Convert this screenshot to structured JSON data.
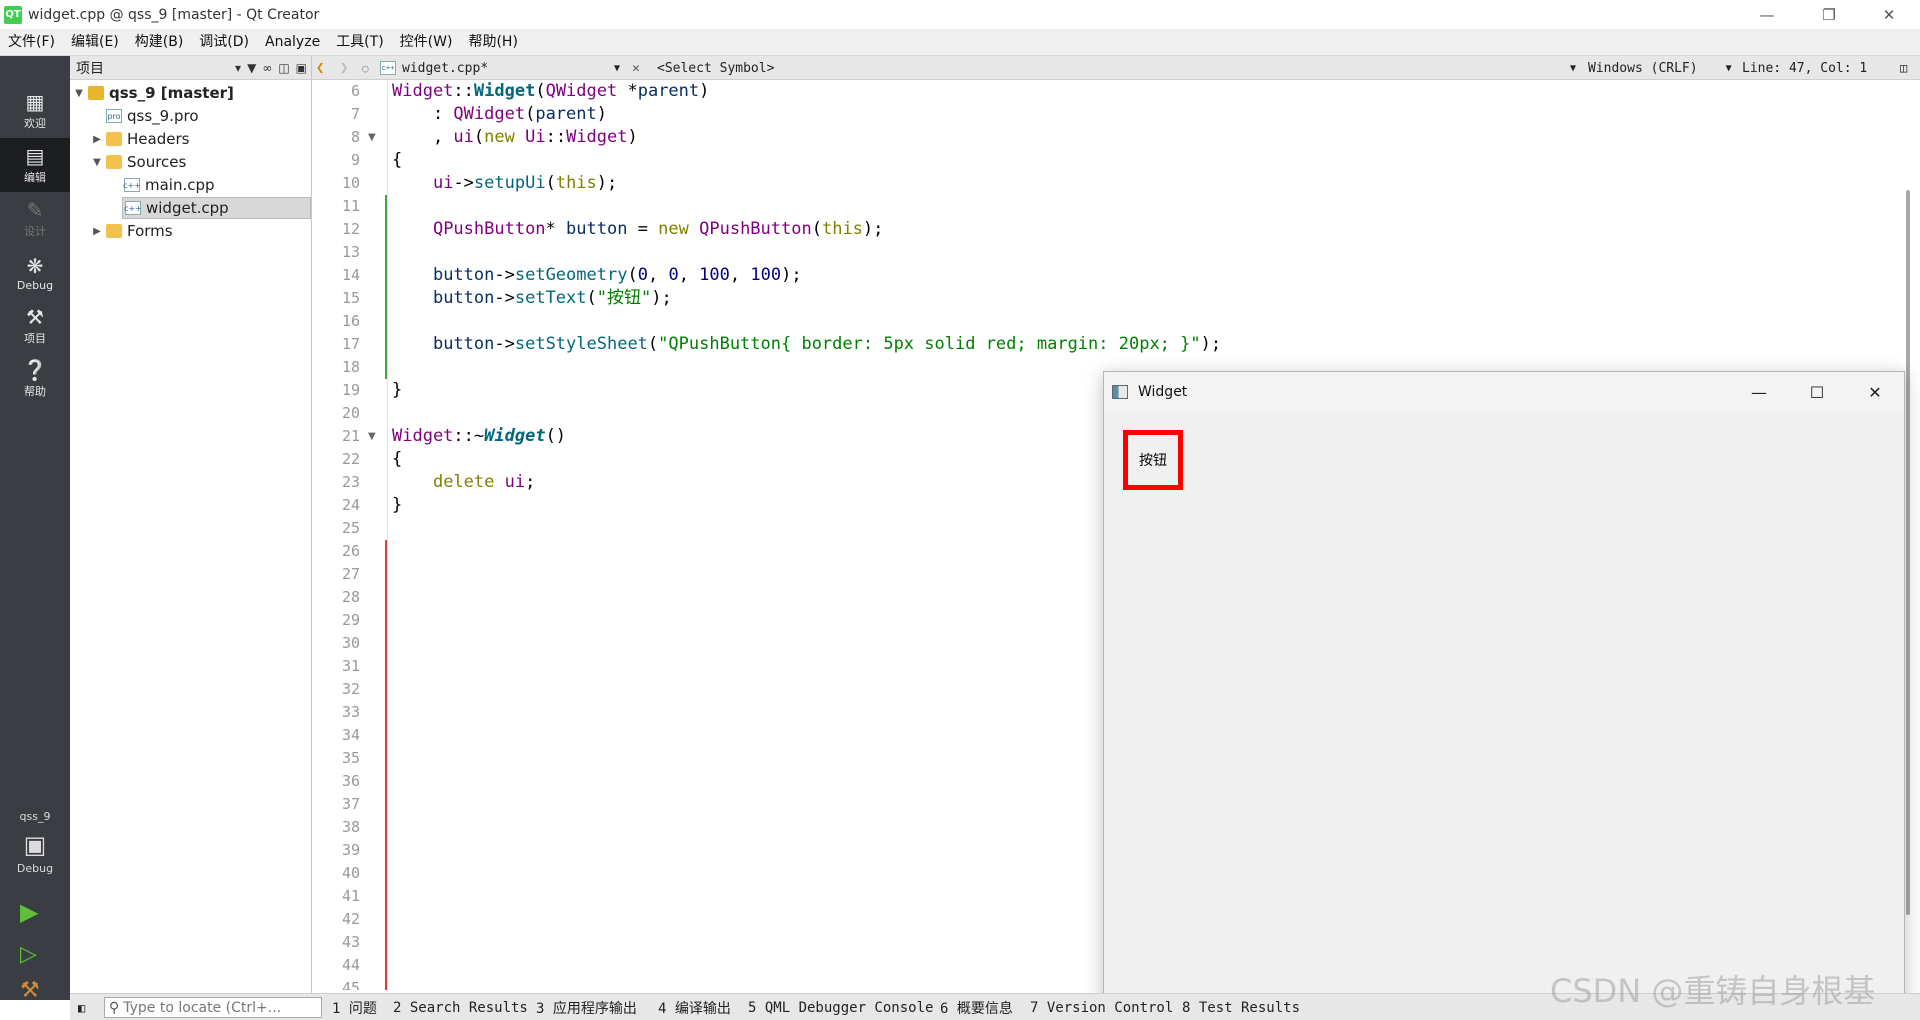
{
  "window": {
    "title": "widget.cpp @ qss_9 [master] - Qt Creator",
    "app_icon": "QT"
  },
  "menu": [
    "文件(F)",
    "编辑(E)",
    "构建(B)",
    "调试(D)",
    "Analyze",
    "工具(T)",
    "控件(W)",
    "帮助(H)"
  ],
  "modes": [
    {
      "icon": "grid-icon",
      "label": "欢迎"
    },
    {
      "icon": "edit-icon",
      "label": "编辑"
    },
    {
      "icon": "pencil-icon",
      "label": "设计"
    },
    {
      "icon": "bug-icon",
      "label": "Debug"
    },
    {
      "icon": "wrench-icon",
      "label": "项目"
    },
    {
      "icon": "help-icon",
      "label": "帮助"
    }
  ],
  "kit": {
    "project": "qss_9",
    "config": "Debug"
  },
  "project_pane": {
    "header": "项目",
    "tree": [
      {
        "label": "qss_9 [master]",
        "bold": true
      },
      {
        "label": "qss_9.pro"
      },
      {
        "label": "Headers"
      },
      {
        "label": "Sources"
      },
      {
        "label": "main.cpp"
      },
      {
        "label": "widget.cpp",
        "selected": true
      },
      {
        "label": "Forms"
      }
    ]
  },
  "editor_toolbar": {
    "file": "widget.cpp*",
    "symbol": "<Select Symbol>",
    "line_ending": "Windows (CRLF)",
    "position": "Line: 47, Col: 1"
  },
  "code": {
    "first_line": 6,
    "last_line": 45,
    "lines": [
      [
        [
          "ty",
          "Widget"
        ],
        [
          "",
          "::"
        ],
        [
          "fb",
          "Widget"
        ],
        [
          "",
          "("
        ],
        [
          "ty",
          "QWidget"
        ],
        [
          "",
          " *"
        ],
        [
          "mb",
          "parent"
        ],
        [
          "",
          ")"
        ]
      ],
      [
        [
          "",
          "    : "
        ],
        [
          "ty",
          "QWidget"
        ],
        [
          "",
          "("
        ],
        [
          "mb",
          "parent"
        ],
        [
          "",
          ")"
        ]
      ],
      [
        [
          "",
          "    , "
        ],
        [
          "ty",
          "ui"
        ],
        [
          "",
          "("
        ],
        [
          "kw",
          "new "
        ],
        [
          "ty",
          "Ui"
        ],
        [
          "",
          "::"
        ],
        [
          "ty",
          "Widget"
        ],
        [
          "",
          ")"
        ]
      ],
      [
        [
          "",
          "{"
        ]
      ],
      [
        [
          "",
          "    "
        ],
        [
          "ty",
          "ui"
        ],
        [
          "",
          "->"
        ],
        [
          "fn",
          "setupUi"
        ],
        [
          "",
          "("
        ],
        [
          "kw",
          "this"
        ],
        [
          "",
          ");"
        ]
      ],
      [],
      [
        [
          "",
          "    "
        ],
        [
          "ty",
          "QPushButton"
        ],
        [
          "",
          "* "
        ],
        [
          "mb",
          "button"
        ],
        [
          "",
          " = "
        ],
        [
          "kw",
          "new "
        ],
        [
          "ty",
          "QPushButton"
        ],
        [
          "",
          "("
        ],
        [
          "kw",
          "this"
        ],
        [
          "",
          ");"
        ]
      ],
      [],
      [
        [
          "",
          "    "
        ],
        [
          "mb",
          "button"
        ],
        [
          "",
          "->"
        ],
        [
          "fn",
          "setGeometry"
        ],
        [
          "",
          "("
        ],
        [
          "nu",
          "0"
        ],
        [
          "",
          ", "
        ],
        [
          "nu",
          "0"
        ],
        [
          "",
          ", "
        ],
        [
          "nu",
          "100"
        ],
        [
          "",
          ", "
        ],
        [
          "nu",
          "100"
        ],
        [
          "",
          ");"
        ]
      ],
      [
        [
          "",
          "    "
        ],
        [
          "mb",
          "button"
        ],
        [
          "",
          "->"
        ],
        [
          "fn",
          "setText"
        ],
        [
          "",
          "("
        ],
        [
          "st",
          "\"按钮\""
        ],
        [
          "",
          ");"
        ]
      ],
      [],
      [
        [
          "",
          "    "
        ],
        [
          "mb",
          "button"
        ],
        [
          "",
          "->"
        ],
        [
          "fn",
          "setStyleSheet"
        ],
        [
          "",
          "("
        ],
        [
          "st",
          "\"QPushButton{ border: 5px solid red; margin: 20px; }\""
        ],
        [
          "",
          ");"
        ]
      ],
      [],
      [
        [
          "",
          "}"
        ]
      ],
      [],
      [
        [
          "ty",
          "Widget"
        ],
        [
          "",
          "::~"
        ],
        [
          "fbi",
          "Widget"
        ],
        [
          "",
          "()"
        ]
      ],
      [
        [
          "",
          "{"
        ]
      ],
      [
        [
          "",
          "    "
        ],
        [
          "kw",
          "delete "
        ],
        [
          "ty",
          "ui"
        ],
        [
          "",
          ";"
        ]
      ],
      [
        [
          "",
          "}"
        ]
      ]
    ]
  },
  "widget_window": {
    "title": "Widget",
    "button_text": "按钮"
  },
  "bottom_bar": {
    "locate_placeholder": "Type to locate (Ctrl+...",
    "tabs": [
      "1 问题",
      "2 Search Results",
      "3 应用程序输出",
      "4 编译输出",
      "5 QML Debugger Console",
      "6 概要信息",
      "7 Version Control",
      "8 Test Results"
    ]
  },
  "watermark": "CSDN @重铸自身根基"
}
